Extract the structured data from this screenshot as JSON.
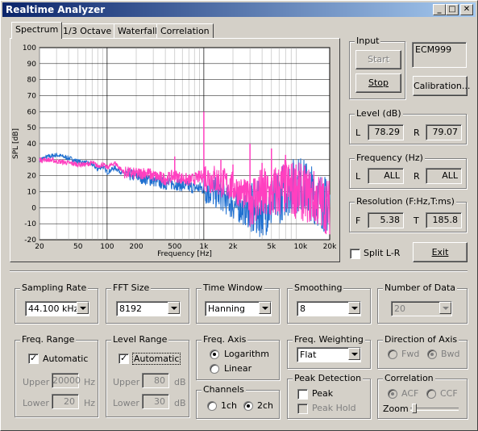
{
  "window": {
    "title": "Realtime Analyzer"
  },
  "tabs": [
    {
      "label": "Spectrum",
      "active": true
    },
    {
      "label": "1/3 Octave",
      "active": false
    },
    {
      "label": "Waterfall",
      "active": false
    },
    {
      "label": "Correlation",
      "active": false
    }
  ],
  "chart_data": {
    "type": "line",
    "ylabel": "SPL [dB]",
    "xlabel": "Frequency  [Hz]",
    "xscale": "log",
    "xlim": [
      20,
      20000
    ],
    "ylim": [
      -20,
      100
    ],
    "x_ticks": [
      "20",
      "50",
      "100",
      "200",
      "500",
      "1k",
      "2k",
      "5k",
      "10k",
      "20k"
    ],
    "y_ticks": [
      "100",
      "90",
      "80",
      "70",
      "60",
      "50",
      "40",
      "30",
      "20",
      "10",
      "0",
      "-10",
      "-20"
    ],
    "grid": true,
    "background": "#ffffff",
    "grid_color": "#c0c0c0",
    "series": [
      {
        "color": "#1e6fd0",
        "x": [
          20,
          25,
          30,
          40,
          50,
          60,
          70,
          80,
          90,
          100,
          120,
          150,
          200,
          250,
          300,
          400,
          500,
          700,
          1000,
          1500,
          2000,
          3000,
          5000,
          7000,
          10000,
          15000,
          20000
        ],
        "values": [
          30,
          32,
          33,
          31,
          29,
          28,
          27,
          24,
          26,
          22,
          25,
          21,
          20,
          18,
          17,
          15,
          15,
          13,
          12,
          8,
          2,
          -3,
          2,
          12,
          15,
          6,
          0
        ]
      },
      {
        "color": "#ff40c0",
        "x": [
          20,
          25,
          30,
          40,
          50,
          60,
          70,
          80,
          90,
          100,
          120,
          150,
          200,
          250,
          300,
          400,
          500,
          700,
          1000,
          1500,
          2000,
          3000,
          5000,
          7000,
          10000,
          15000,
          20000
        ],
        "values": [
          30,
          30,
          29,
          28,
          27,
          27,
          28,
          26,
          27,
          25,
          28,
          22,
          21,
          22,
          20,
          18,
          20,
          17,
          20,
          16,
          13,
          6,
          8,
          13,
          10,
          5,
          0
        ]
      }
    ],
    "peaks": [
      {
        "x": 1000,
        "y": 60
      },
      {
        "x": 3000,
        "y": 40
      },
      {
        "x": 5000,
        "y": 37
      },
      {
        "x": 7000,
        "y": 33
      },
      {
        "x": 500,
        "y": 32
      },
      {
        "x": 1500,
        "y": 30
      },
      {
        "x": 2000,
        "y": 27
      },
      {
        "x": 4000,
        "y": 28
      },
      {
        "x": 9000,
        "y": 27
      }
    ]
  },
  "input": {
    "group_label": "Input",
    "device": "ECM999",
    "start_label": "Start",
    "stop_label": "Stop",
    "calibration_label": "Calibration..."
  },
  "level": {
    "group_label": "Level (dB)",
    "l_label": "L",
    "r_label": "R",
    "l_value": "78.29",
    "r_value": "79.07"
  },
  "frequency": {
    "group_label": "Frequency (Hz)",
    "l_label": "L",
    "r_label": "R",
    "l_value": "ALL",
    "r_value": "ALL"
  },
  "resolution": {
    "group_label": "Resolution (F:Hz,T:ms)",
    "f_label": "F",
    "t_label": "T",
    "f_value": "5.38",
    "t_value": "185.8"
  },
  "split_lr": {
    "label": "Split L-R",
    "checked": false
  },
  "exit_label": "Exit",
  "sampling_rate": {
    "group_label": "Sampling Rate",
    "value": "44.100 kHz"
  },
  "fft_size": {
    "group_label": "FFT Size",
    "value": "8192"
  },
  "time_window": {
    "group_label": "Time Window",
    "value": "Hanning"
  },
  "smoothing": {
    "group_label": "Smoothing",
    "value": "8"
  },
  "number_of_data": {
    "group_label": "Number of Data",
    "value": "20"
  },
  "freq_range": {
    "group_label": "Freq. Range",
    "automatic_label": "Automatic",
    "automatic_checked": true,
    "upper_label": "Upper",
    "lower_label": "Lower",
    "upper_value": "20000",
    "lower_value": "20",
    "unit": "Hz"
  },
  "level_range": {
    "group_label": "Level Range",
    "automatic_label": "Automatic",
    "automatic_checked": true,
    "upper_label": "Upper",
    "lower_label": "Lower",
    "upper_value": "80",
    "lower_value": "30",
    "unit": "dB"
  },
  "freq_axis": {
    "group_label": "Freq. Axis",
    "options": [
      "Logarithm",
      "Linear"
    ],
    "selected": "Logarithm"
  },
  "channels": {
    "group_label": "Channels",
    "options": [
      "1ch",
      "2ch"
    ],
    "selected": "2ch"
  },
  "freq_weighting": {
    "group_label": "Freq. Weighting",
    "value": "Flat"
  },
  "peak_detection": {
    "group_label": "Peak Detection",
    "peak_label": "Peak",
    "peak_hold_label": "Peak Hold"
  },
  "direction_of_axis": {
    "group_label": "Direction of Axis",
    "options": [
      "Fwd",
      "Bwd"
    ],
    "selected": "Bwd"
  },
  "correlation": {
    "group_label": "Correlation",
    "options": [
      "ACF",
      "CCF"
    ],
    "selected": "ACF",
    "zoom_label": "Zoom"
  }
}
